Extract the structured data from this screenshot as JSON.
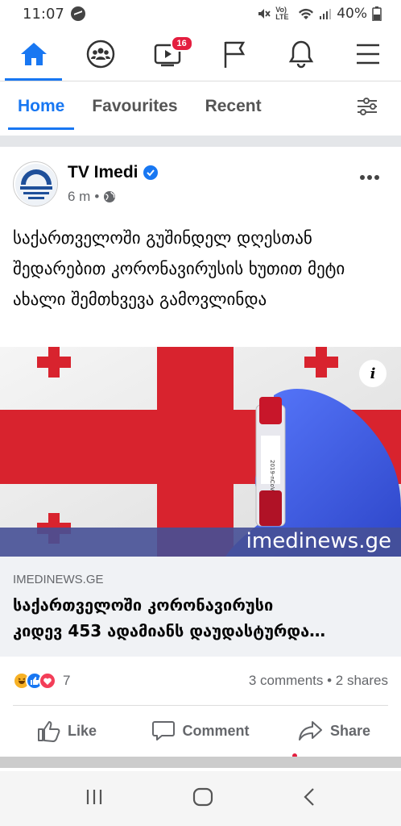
{
  "status": {
    "time": "11:07",
    "volte": "Vo) LTE",
    "battery": "40%"
  },
  "nav": {
    "tabs": [
      {
        "icon": "home-icon",
        "active": true
      },
      {
        "icon": "groups-icon",
        "active": false
      },
      {
        "icon": "watch-icon",
        "active": false,
        "badge": "16"
      },
      {
        "icon": "pages-flag-icon",
        "active": false
      },
      {
        "icon": "bell-icon",
        "active": false
      },
      {
        "icon": "menu-icon",
        "active": false
      }
    ]
  },
  "feed_tabs": {
    "home": "Home",
    "favourites": "Favourites",
    "recent": "Recent"
  },
  "post": {
    "page_name": "TV Imedi",
    "time": "6 m",
    "text": "საქართველოში გუშინდელ დღესთან შედარებით კორონავირუსის ხუთით მეტი ახალი შემთხვევა გამოვლინდა",
    "image": {
      "watermark": "imedinews.ge",
      "tube_label": "2019-nCoV"
    },
    "link": {
      "domain": "IMEDINEWS.GE",
      "title": "საქართველოში კორონავირუსი\nკიდევ 453 ადამიანს დაუდასტურდა…"
    },
    "reactions": {
      "count": "7",
      "engagement": "3 comments • 2 shares"
    },
    "actions": {
      "like": "Like",
      "comment": "Comment",
      "share": "Share"
    }
  },
  "colors": {
    "accent": "#1877f2",
    "flag_red": "#d8232e",
    "badge": "#e41e3f"
  }
}
